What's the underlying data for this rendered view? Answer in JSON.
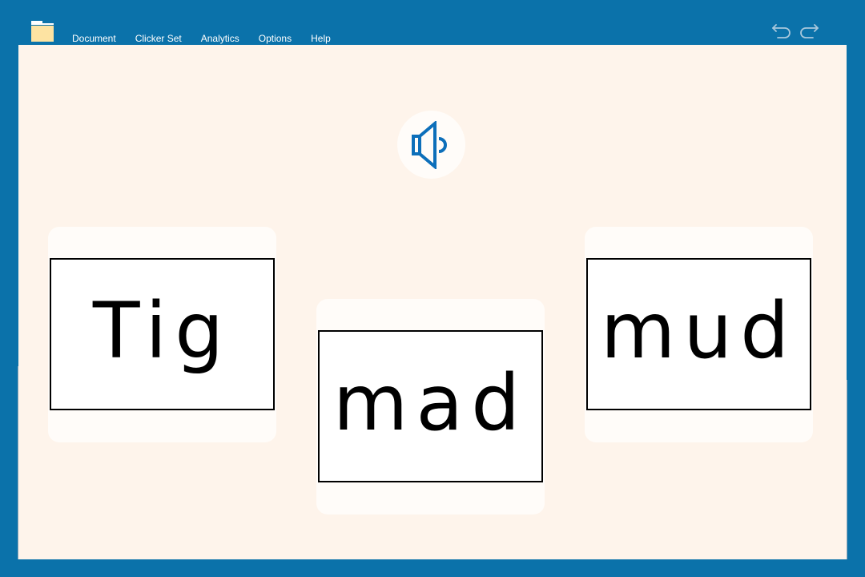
{
  "menu": {
    "folder_icon": "folder-icon",
    "items": [
      {
        "label": "Document"
      },
      {
        "label": "Clicker Set"
      },
      {
        "label": "Analytics"
      },
      {
        "label": "Options"
      },
      {
        "label": "Help"
      }
    ]
  },
  "toolbar": {
    "undo_icon": "undo-icon",
    "redo_icon": "redo-icon"
  },
  "prompt": {
    "icon": "speaker-icon"
  },
  "cards": [
    {
      "word": "Tig"
    },
    {
      "word": "mad"
    },
    {
      "word": "mud"
    }
  ],
  "colors": {
    "frame": "#0b72aa",
    "canvas": "#fef4eb",
    "card": "#fffcf9",
    "speaker_accent": "#0d6fba",
    "folder": "#fde3a2"
  }
}
